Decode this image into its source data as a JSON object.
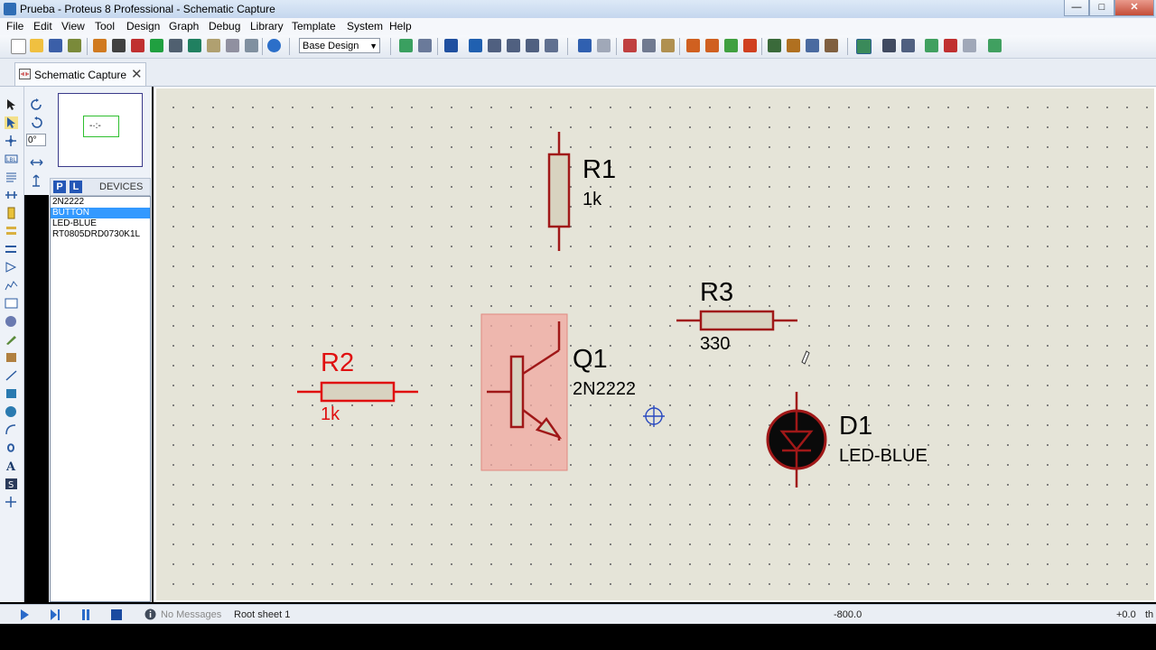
{
  "window": {
    "title": "Prueba - Proteus 8 Professional - Schematic Capture",
    "min": "—",
    "max": "□",
    "close": "✕"
  },
  "menu": [
    "File",
    "Edit",
    "View",
    "Tool",
    "Design",
    "Graph",
    "Debug",
    "Library",
    "Template",
    "System",
    "Help"
  ],
  "toolbar": {
    "design_select": "Base Design"
  },
  "tab": {
    "label": "Schematic Capture",
    "close": "✕"
  },
  "sidebar": {
    "rotation": "0°",
    "overview_marker": "-·:-"
  },
  "devices": {
    "p_label": "P",
    "l_label": "L",
    "title": "DEVICES",
    "items": [
      "2N2222",
      "BUTTON",
      "LED-BLUE",
      "RT0805DRD0730K1L"
    ],
    "selected_index": 1
  },
  "schematic": {
    "r1": {
      "ref": "R1",
      "value": "1k"
    },
    "r2": {
      "ref": "R2",
      "value": "1k",
      "color": "#e01010"
    },
    "r3": {
      "ref": "R3",
      "value": "330"
    },
    "q1": {
      "ref": "Q1",
      "value": "2N2222"
    },
    "d1": {
      "ref": "D1",
      "value": "LED-BLUE"
    },
    "wire_color": "#a01818",
    "body_color": "#d8d3c0",
    "selection_color": "#f0a8a0"
  },
  "status": {
    "messages": "No Messages",
    "sheet": "Root sheet 1",
    "coord_x": "-800.0",
    "coord_y": "+0.0",
    "units": "th"
  }
}
